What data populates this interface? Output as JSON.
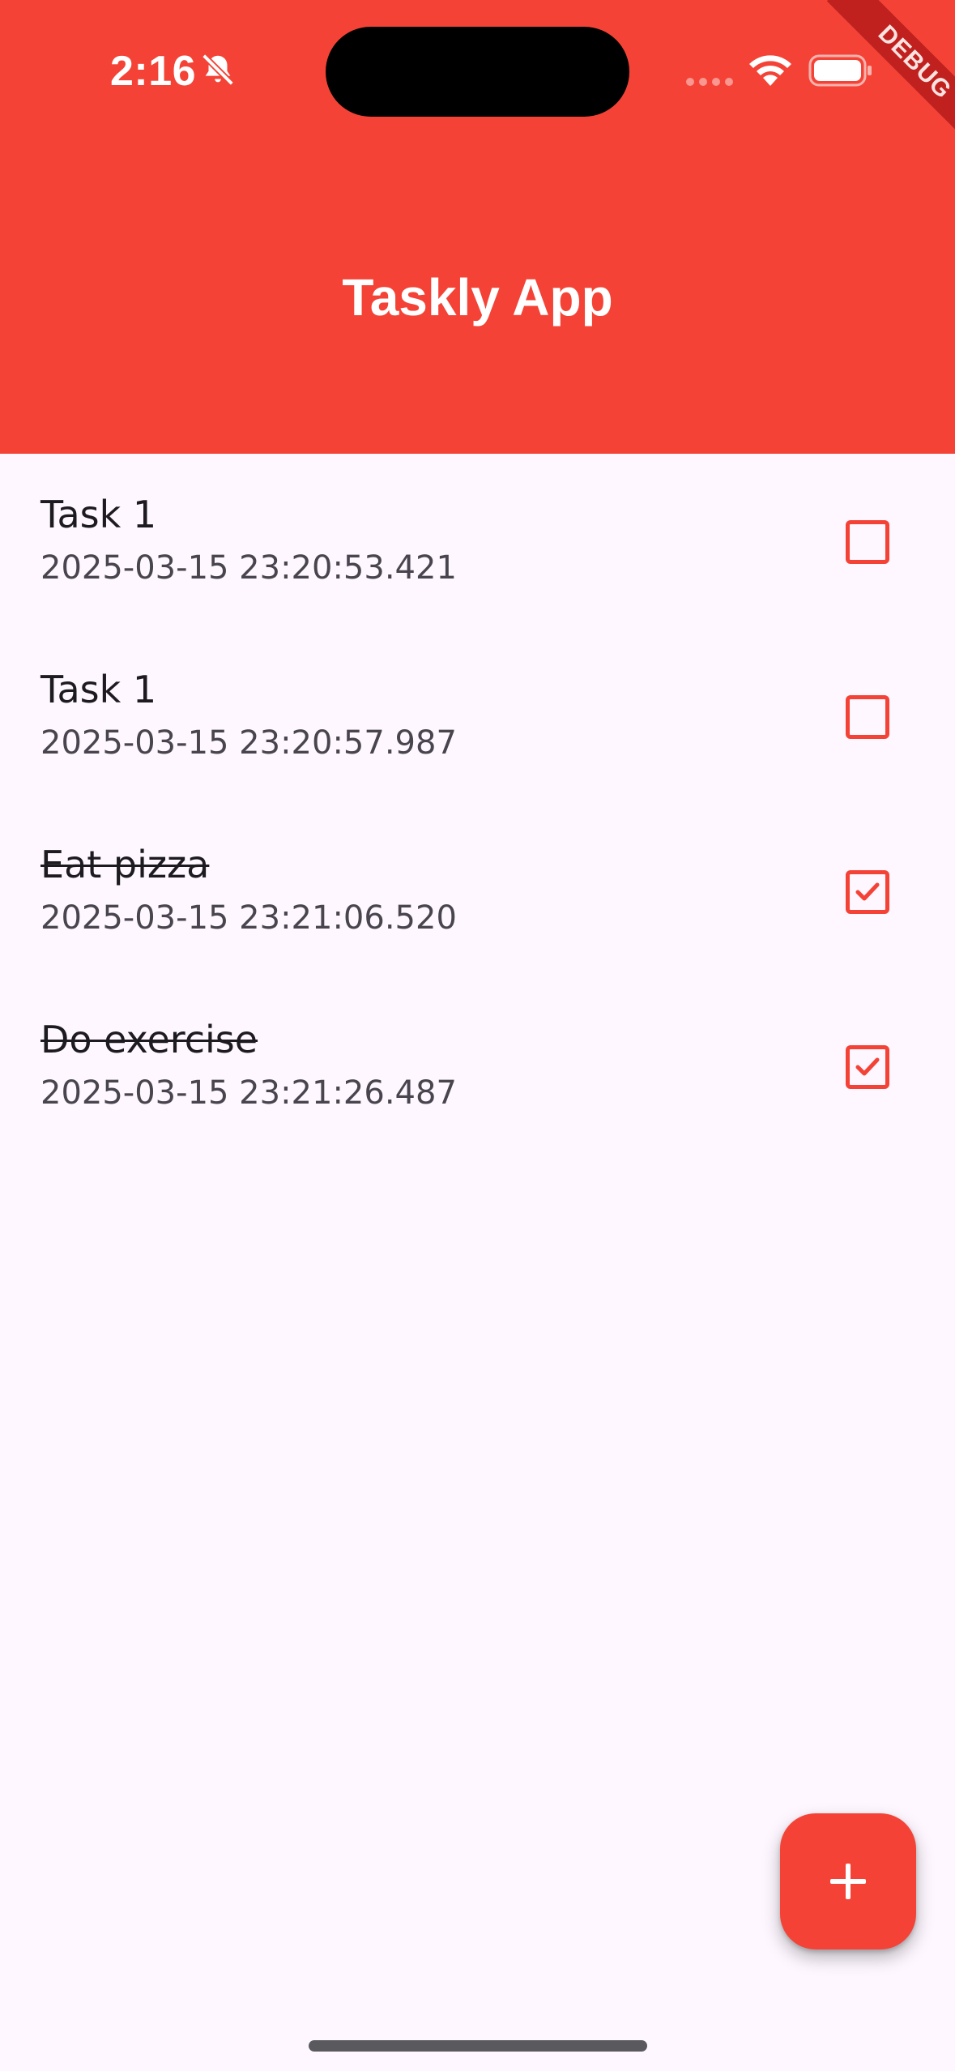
{
  "status_bar": {
    "time": "2:16",
    "icons": [
      "bell-slash-icon",
      "cellular-signal-icon",
      "wifi-icon",
      "battery-icon"
    ]
  },
  "debug_banner": "DEBUG",
  "app_bar": {
    "title": "Taskly App",
    "background_color": "#F44336"
  },
  "tasks": [
    {
      "title": "Task 1",
      "timestamp": "2025-03-15 23:20:53.421",
      "done": false
    },
    {
      "title": "Task 1",
      "timestamp": "2025-03-15 23:20:57.987",
      "done": false
    },
    {
      "title": "Eat pizza",
      "timestamp": "2025-03-15 23:21:06.520",
      "done": true
    },
    {
      "title": "Do exercise",
      "timestamp": "2025-03-15 23:21:26.487",
      "done": true
    }
  ],
  "fab": {
    "icon": "plus-icon",
    "color": "#F44336"
  },
  "colors": {
    "accent": "#F44336",
    "background": "#FEF7FF",
    "text_primary": "#1D1B20",
    "text_secondary": "#49454F"
  }
}
